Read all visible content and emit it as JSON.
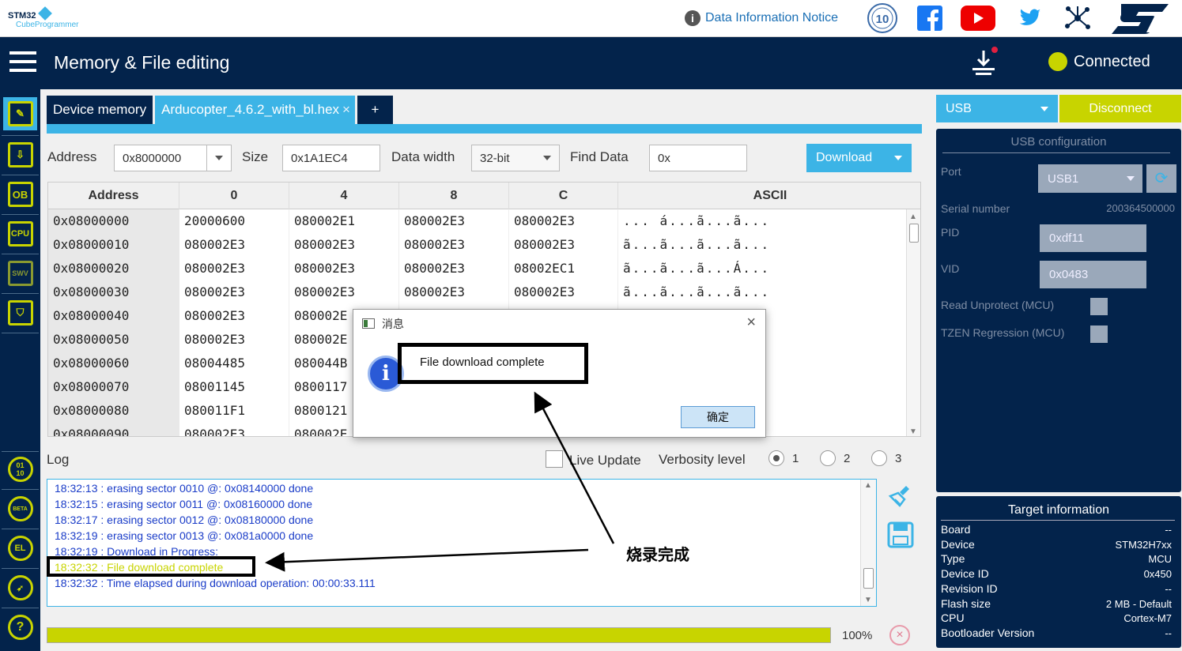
{
  "app": {
    "logo_line1": "STM32",
    "logo_line2": "CubeProgrammer"
  },
  "topbar": {
    "notice": "Data Information Notice",
    "icons": [
      "info-icon",
      "10-year-badge-icon",
      "facebook-icon",
      "youtube-icon",
      "twitter-icon",
      "network-icon",
      "st-logo-icon"
    ]
  },
  "header": {
    "title": "Memory & File editing",
    "status": "Connected"
  },
  "tabs": [
    {
      "label": "Device memory"
    },
    {
      "label": "Arducopter_4.6.2_with_bl.hex",
      "close": "×"
    },
    {
      "label": "+"
    }
  ],
  "toolbar": {
    "address_label": "Address",
    "address_value": "0x8000000",
    "size_label": "Size",
    "size_value": "0x1A1EC4",
    "width_label": "Data width",
    "width_value": "32-bit",
    "find_label": "Find Data",
    "find_value": "0x",
    "download_label": "Download"
  },
  "table": {
    "headers": [
      "Address",
      "0",
      "4",
      "8",
      "C",
      "ASCII"
    ],
    "rows": [
      [
        "0x08000000",
        "20000600",
        "080002E1",
        "080002E3",
        "080002E3",
        "...  á...ã...ã..."
      ],
      [
        "0x08000010",
        "080002E3",
        "080002E3",
        "080002E3",
        "080002E3",
        "ã...ã...ã...ã..."
      ],
      [
        "0x08000020",
        "080002E3",
        "080002E3",
        "080002E3",
        "08002EC1",
        "ã...ã...ã...Á..."
      ],
      [
        "0x08000030",
        "080002E3",
        "080002E3",
        "080002E3",
        "080002E3",
        "ã...ã...ã...ã..."
      ],
      [
        "0x08000040",
        "080002E3",
        "080002E",
        "",
        "",
        ""
      ],
      [
        "0x08000050",
        "080002E3",
        "080002E",
        "",
        "",
        ""
      ],
      [
        "0x08000060",
        "08004485",
        "080044B",
        "",
        "",
        ""
      ],
      [
        "0x08000070",
        "08001145",
        "0800117",
        "",
        "",
        ""
      ],
      [
        "0x08000080",
        "080011F1",
        "0800121",
        "",
        "",
        ""
      ],
      [
        "0x08000090",
        "080002E3",
        "080002E",
        "",
        "",
        ""
      ]
    ]
  },
  "log": {
    "label": "Log",
    "live_update": "Live Update",
    "verbosity_label": "Verbosity level",
    "levels": [
      "1",
      "2",
      "3"
    ],
    "lines": [
      "18:32:13 : erasing sector 0010 @: 0x08140000 done",
      "18:32:15 : erasing sector 0011 @: 0x08160000 done",
      "18:32:17 : erasing sector 0012 @: 0x08180000 done",
      "18:32:19 : erasing sector 0013 @: 0x081a0000 done",
      "18:32:19 : Download in Progress:",
      "18:32:32 : File download complete",
      "18:32:32 : Time elapsed during download operation: 00:00:33.111"
    ],
    "line_colors": [
      "#1a3cc8",
      "#1a3cc8",
      "#1a3cc8",
      "#1a3cc8",
      "#1a3cc8",
      "#c8d400",
      "#1a3cc8"
    ]
  },
  "progress": {
    "percent_label": "100%",
    "value": 1.0
  },
  "right": {
    "interface": "USB",
    "disconnect": "Disconnect",
    "config_title": "USB configuration",
    "port_label": "Port",
    "port_value": "USB1",
    "serial_label": "Serial number",
    "serial_value": "200364500000",
    "pid_label": "PID",
    "pid_value": "0xdf11",
    "vid_label": "VID",
    "vid_value": "0x0483",
    "read_unprotect": "Read Unprotect (MCU)",
    "tzen": "TZEN Regression (MCU)"
  },
  "target": {
    "title": "Target information",
    "items": [
      {
        "label": "Board",
        "value": "--"
      },
      {
        "label": "Device",
        "value": "STM32H7xx"
      },
      {
        "label": "Type",
        "value": "MCU"
      },
      {
        "label": "Device ID",
        "value": "0x450"
      },
      {
        "label": "Revision ID",
        "value": "--"
      },
      {
        "label": "Flash size",
        "value": "2 MB - Default"
      },
      {
        "label": "CPU",
        "value": "Cortex-M7"
      },
      {
        "label": "Bootloader Version",
        "value": "--"
      }
    ]
  },
  "dialog": {
    "title": "消息",
    "message": "File download complete",
    "ok": "确定"
  },
  "annotation": {
    "text": "烧录完成"
  },
  "colors": {
    "navy": "#03234b",
    "accent": "#3cb4e6",
    "lime": "#c8d400"
  }
}
